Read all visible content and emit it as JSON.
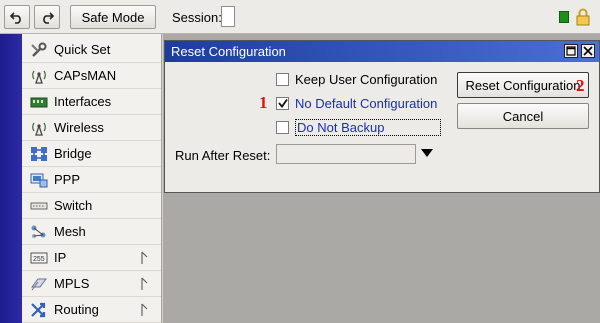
{
  "toolbar": {
    "undo_icon": "undo-icon",
    "redo_icon": "redo-icon",
    "safe_mode_label": "Safe Mode",
    "session_label": "Session:",
    "session_value": "",
    "status_color": "#1d8f1d",
    "lock_icon": "lock-icon"
  },
  "sidebar": {
    "items": [
      {
        "label": "Quick Set",
        "icon": "quick-set-icon",
        "submenu": false
      },
      {
        "label": "CAPsMAN",
        "icon": "antenna-icon",
        "submenu": false
      },
      {
        "label": "Interfaces",
        "icon": "interfaces-icon",
        "submenu": false
      },
      {
        "label": "Wireless",
        "icon": "antenna-icon",
        "submenu": false
      },
      {
        "label": "Bridge",
        "icon": "bridge-icon",
        "submenu": false
      },
      {
        "label": "PPP",
        "icon": "ppp-icon",
        "submenu": false
      },
      {
        "label": "Switch",
        "icon": "switch-icon",
        "submenu": false
      },
      {
        "label": "Mesh",
        "icon": "mesh-icon",
        "submenu": false
      },
      {
        "label": "IP",
        "icon": "ip-icon",
        "submenu": true
      },
      {
        "label": "MPLS",
        "icon": "mpls-icon",
        "submenu": true
      },
      {
        "label": "Routing",
        "icon": "routing-icon",
        "submenu": true
      }
    ]
  },
  "dialog": {
    "title": "Reset Configuration",
    "options": [
      {
        "label": "Keep User Configuration",
        "checked": false
      },
      {
        "label": "No Default Configuration",
        "checked": true
      },
      {
        "label": "Do Not Backup",
        "checked": false
      }
    ],
    "run_after_reset_label": "Run After Reset:",
    "run_after_reset_value": "",
    "reset_button": "Reset Configuration",
    "cancel_button": "Cancel",
    "marker_1": "1",
    "marker_2": "2"
  },
  "colors": {
    "title_bar": "#1e3c9f",
    "marker": "#e01010",
    "link_blue": "#1a2fb3"
  }
}
